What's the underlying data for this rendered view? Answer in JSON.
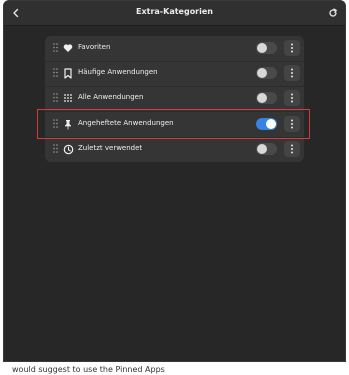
{
  "window": {
    "title": "Extra-Kategorien"
  },
  "items": [
    {
      "label": "Favoriten",
      "icon": "heart-icon",
      "enabled": false
    },
    {
      "label": "Häufige Anwendungen",
      "icon": "bookmark-icon",
      "enabled": false
    },
    {
      "label": "Alle Anwendungen",
      "icon": "grid-icon",
      "enabled": false
    },
    {
      "label": "Angeheftete Anwendungen",
      "icon": "pin-icon",
      "enabled": true
    },
    {
      "label": "Zuletzt verwendet",
      "icon": "clock-icon",
      "enabled": false
    }
  ],
  "colors": {
    "accent": "#3584e4",
    "highlight": "#d33b3b"
  },
  "footer_text": "would suggest to use the Pinned Apps"
}
